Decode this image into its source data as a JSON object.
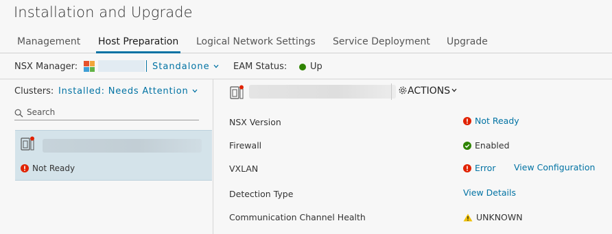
{
  "page": {
    "title": "Installation and Upgrade"
  },
  "tabs": [
    {
      "label": "Management"
    },
    {
      "label": "Host Preparation"
    },
    {
      "label": "Logical Network Settings"
    },
    {
      "label": "Service Deployment"
    },
    {
      "label": "Upgrade"
    }
  ],
  "manager": {
    "label": "NSX Manager:",
    "mode": "Standalone",
    "eam_label": "EAM Status:",
    "eam_status": "Up",
    "eam_color": "#2f8400"
  },
  "clusters": {
    "label": "Clusters:",
    "filter": "Installed: Needs Attention",
    "search_placeholder": "Search",
    "items": [
      {
        "status": "Not Ready",
        "icon": "host-cluster-icon"
      }
    ]
  },
  "detail": {
    "actions_label": "ACTIONS",
    "rows": [
      {
        "label": "NSX Version",
        "value": "Not Ready"
      },
      {
        "label": "Firewall",
        "value": "Enabled"
      },
      {
        "label": "VXLAN",
        "value": "Error",
        "link": "View Configuration"
      },
      {
        "label": "Detection Type",
        "value": "View Details"
      },
      {
        "label": "Communication Channel Health",
        "value": "UNKNOWN"
      }
    ]
  },
  "colors": {
    "accent": "#0072a3",
    "error": "#e12200",
    "success": "#2f8400",
    "warning": "#efc006",
    "selected_row": "#d4e3ea"
  }
}
